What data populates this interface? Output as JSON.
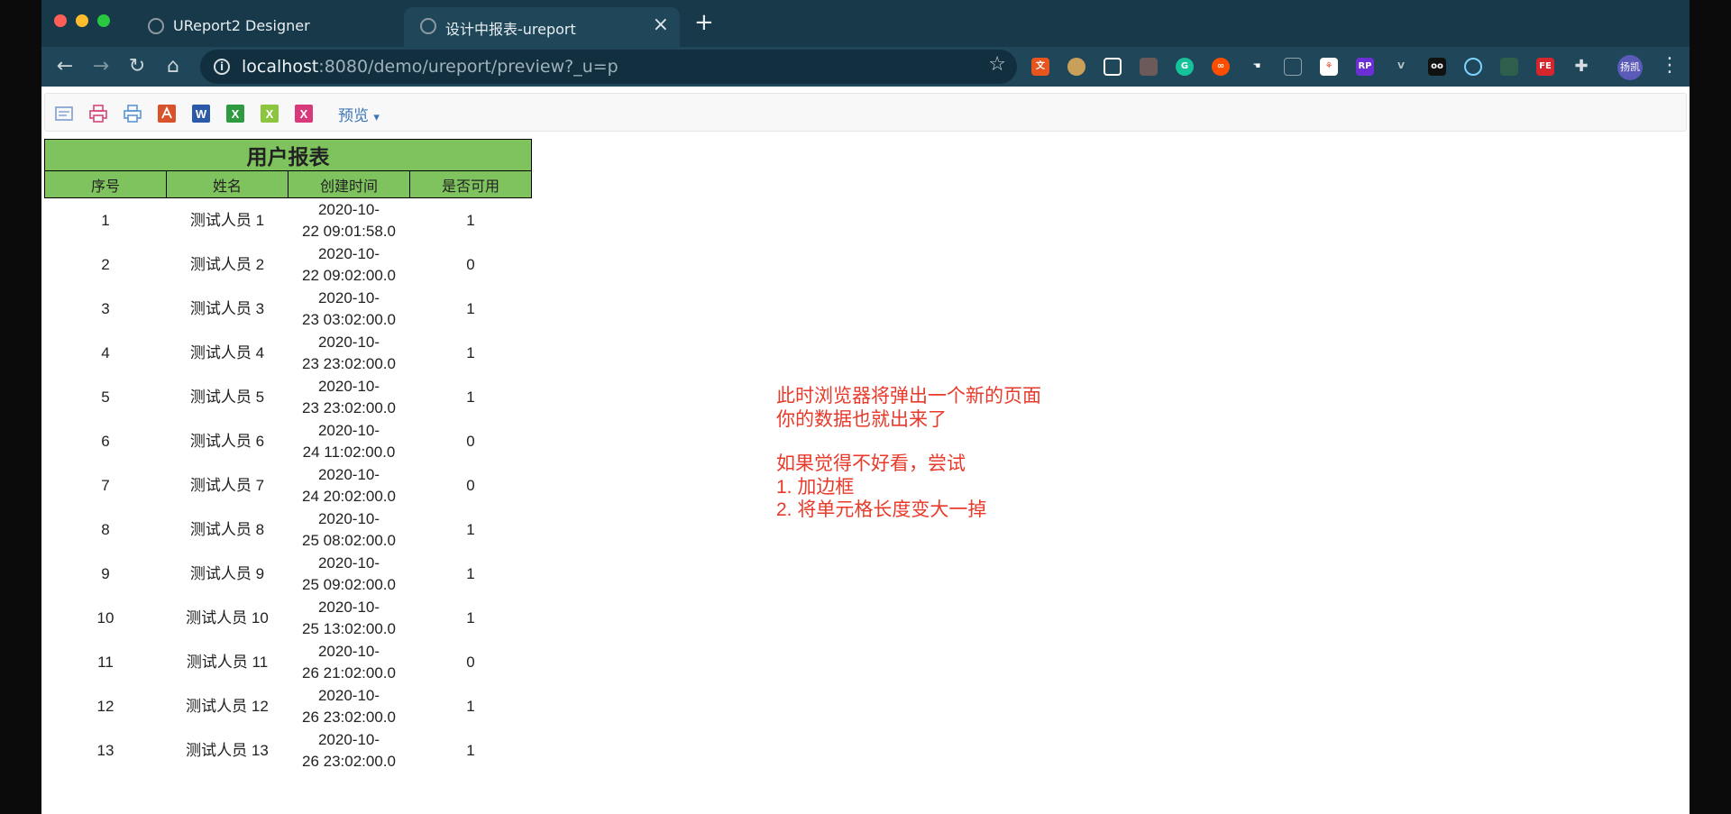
{
  "browser": {
    "tabs": [
      {
        "title": "UReport2 Designer",
        "active": false
      },
      {
        "title": "设计中报表-ureport",
        "active": true
      }
    ],
    "new_tab": "+",
    "url_host": "localhost",
    "url_rest": ":8080/demo/ureport/preview?_u=p",
    "profile_label": "扬凯"
  },
  "report_toolbar": {
    "icons": [
      "page-setup-icon",
      "print-icon",
      "pdf-print-icon",
      "pdf-export-icon",
      "word-export-icon",
      "excel-export-icon",
      "excel-paging-export-icon",
      "excel-sheet-export-icon"
    ],
    "preview_label": "预览",
    "preview_caret": "▾"
  },
  "report": {
    "title": "用户报表",
    "columns": [
      "序号",
      "姓名",
      "创建时间",
      "是否可用"
    ],
    "rows": [
      {
        "id": "1",
        "name": "测试人员 1",
        "date": "2020-10-",
        "time": "22 09:01:58.0",
        "enabled": "1"
      },
      {
        "id": "2",
        "name": "测试人员 2",
        "date": "2020-10-",
        "time": "22 09:02:00.0",
        "enabled": "0"
      },
      {
        "id": "3",
        "name": "测试人员 3",
        "date": "2020-10-",
        "time": "23 03:02:00.0",
        "enabled": "1"
      },
      {
        "id": "4",
        "name": "测试人员 4",
        "date": "2020-10-",
        "time": "23 23:02:00.0",
        "enabled": "1"
      },
      {
        "id": "5",
        "name": "测试人员 5",
        "date": "2020-10-",
        "time": "23 23:02:00.0",
        "enabled": "1"
      },
      {
        "id": "6",
        "name": "测试人员 6",
        "date": "2020-10-",
        "time": "24 11:02:00.0",
        "enabled": "0"
      },
      {
        "id": "7",
        "name": "测试人员 7",
        "date": "2020-10-",
        "time": "24 20:02:00.0",
        "enabled": "0"
      },
      {
        "id": "8",
        "name": "测试人员 8",
        "date": "2020-10-",
        "time": "25 08:02:00.0",
        "enabled": "1"
      },
      {
        "id": "9",
        "name": "测试人员 9",
        "date": "2020-10-",
        "time": "25 09:02:00.0",
        "enabled": "1"
      },
      {
        "id": "10",
        "name": "测试人员 10",
        "date": "2020-10-",
        "time": "25 13:02:00.0",
        "enabled": "1"
      },
      {
        "id": "11",
        "name": "测试人员 11",
        "date": "2020-10-",
        "time": "26 21:02:00.0",
        "enabled": "0"
      },
      {
        "id": "12",
        "name": "测试人员 12",
        "date": "2020-10-",
        "time": "26 23:02:00.0",
        "enabled": "1"
      },
      {
        "id": "13",
        "name": "测试人员 13",
        "date": "2020-10-",
        "time": "26 23:02:00.0",
        "enabled": "1"
      }
    ]
  },
  "annotation": {
    "lines": [
      "此时浏览器将弹出一个新的页面",
      "你的数据也就出来了",
      "",
      "如果觉得不好看，尝试",
      "1. 加边框",
      "2. 将单元格长度变大一掉"
    ],
    "color": "#e83a2b"
  }
}
